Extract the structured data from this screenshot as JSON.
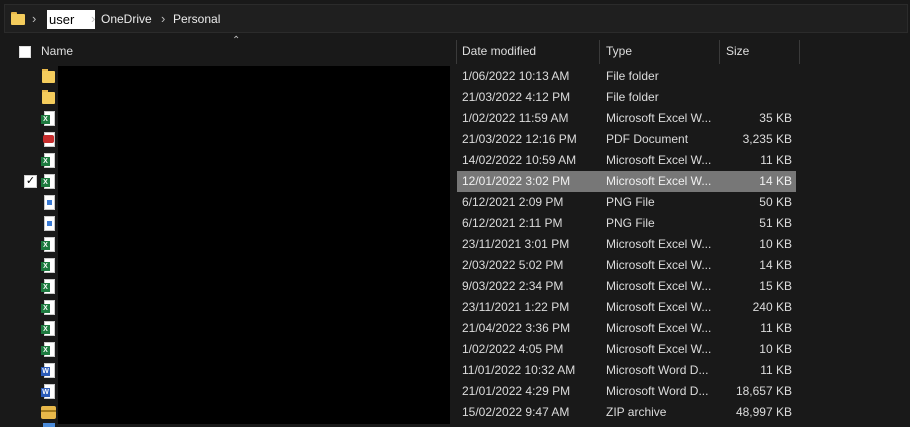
{
  "address": {
    "crumbs": [
      "user",
      "OneDrive",
      "Personal"
    ]
  },
  "columns": {
    "name": "Name",
    "date": "Date modified",
    "type": "Type",
    "size": "Size"
  },
  "files": [
    {
      "icon": "folder-icon",
      "date": "1/06/2022 10:13 AM",
      "type": "File folder",
      "size": ""
    },
    {
      "icon": "folder-icon",
      "date": "21/03/2022 4:12 PM",
      "type": "File folder",
      "size": ""
    },
    {
      "icon": "excel-file-icon",
      "date": "1/02/2022 11:59 AM",
      "type": "Microsoft Excel W...",
      "size": "35 KB"
    },
    {
      "icon": "pdf-file-icon",
      "date": "21/03/2022 12:16 PM",
      "type": "PDF Document",
      "size": "3,235 KB"
    },
    {
      "icon": "excel-file-icon",
      "date": "14/02/2022 10:59 AM",
      "type": "Microsoft Excel W...",
      "size": "11 KB"
    },
    {
      "icon": "excel-file-icon",
      "date": "12/01/2022 3:02 PM",
      "type": "Microsoft Excel W...",
      "size": "14 KB",
      "selected": true
    },
    {
      "icon": "png-file-icon",
      "date": "6/12/2021 2:09 PM",
      "type": "PNG File",
      "size": "50 KB"
    },
    {
      "icon": "png-file-icon",
      "date": "6/12/2021 2:11 PM",
      "type": "PNG File",
      "size": "51 KB"
    },
    {
      "icon": "excel-file-icon",
      "date": "23/11/2021 3:01 PM",
      "type": "Microsoft Excel W...",
      "size": "10 KB"
    },
    {
      "icon": "excel-file-icon",
      "date": "2/03/2022 5:02 PM",
      "type": "Microsoft Excel W...",
      "size": "14 KB"
    },
    {
      "icon": "excel-file-icon",
      "date": "9/03/2022 2:34 PM",
      "type": "Microsoft Excel W...",
      "size": "15 KB"
    },
    {
      "icon": "excel-file-icon",
      "date": "23/11/2021 1:22 PM",
      "type": "Microsoft Excel W...",
      "size": "240 KB"
    },
    {
      "icon": "excel-file-icon",
      "date": "21/04/2022 3:36 PM",
      "type": "Microsoft Excel W...",
      "size": "11 KB"
    },
    {
      "icon": "excel-file-icon",
      "date": "1/02/2022 4:05 PM",
      "type": "Microsoft Excel W...",
      "size": "10 KB"
    },
    {
      "icon": "word-file-icon",
      "date": "11/01/2022 10:32 AM",
      "type": "Microsoft Word D...",
      "size": "11 KB"
    },
    {
      "icon": "word-file-icon",
      "date": "21/01/2022 4:29 PM",
      "type": "Microsoft Word D...",
      "size": "18,657 KB"
    },
    {
      "icon": "zip-file-icon",
      "date": "15/02/2022 9:47 AM",
      "type": "ZIP archive",
      "size": "48,997 KB"
    }
  ]
}
